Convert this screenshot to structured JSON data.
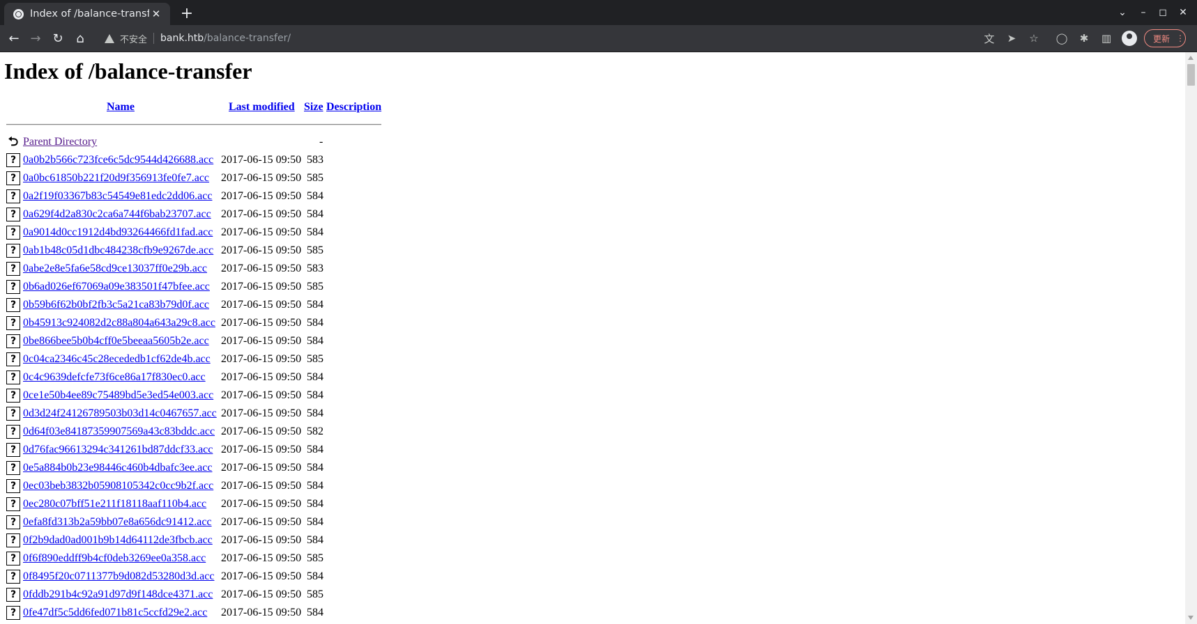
{
  "browser": {
    "tab_title": "Index of /balance-transfer",
    "tab_close": "✕",
    "new_tab": "+",
    "omnibox": {
      "security_label": "不安全",
      "host": "bank.htb",
      "path": "/balance-transfer/"
    },
    "update_label": "更新"
  },
  "page": {
    "heading": "Index of /balance-transfer",
    "columns": {
      "name": "Name",
      "last_modified": "Last modified",
      "size": "Size",
      "description": "Description"
    },
    "parent": {
      "label": "Parent Directory",
      "size": "-"
    },
    "files": [
      {
        "name": "0a0b2b566c723fce6c5dc9544d426688.acc",
        "modified": "2017-06-15 09:50",
        "size": "583"
      },
      {
        "name": "0a0bc61850b221f20d9f356913fe0fe7.acc",
        "modified": "2017-06-15 09:50",
        "size": "585"
      },
      {
        "name": "0a2f19f03367b83c54549e81edc2dd06.acc",
        "modified": "2017-06-15 09:50",
        "size": "584"
      },
      {
        "name": "0a629f4d2a830c2ca6a744f6bab23707.acc",
        "modified": "2017-06-15 09:50",
        "size": "584"
      },
      {
        "name": "0a9014d0cc1912d4bd93264466fd1fad.acc",
        "modified": "2017-06-15 09:50",
        "size": "584"
      },
      {
        "name": "0ab1b48c05d1dbc484238cfb9e9267de.acc",
        "modified": "2017-06-15 09:50",
        "size": "585"
      },
      {
        "name": "0abe2e8e5fa6e58cd9ce13037ff0e29b.acc",
        "modified": "2017-06-15 09:50",
        "size": "583"
      },
      {
        "name": "0b6ad026ef67069a09e383501f47bfee.acc",
        "modified": "2017-06-15 09:50",
        "size": "585"
      },
      {
        "name": "0b59b6f62b0bf2fb3c5a21ca83b79d0f.acc",
        "modified": "2017-06-15 09:50",
        "size": "584"
      },
      {
        "name": "0b45913c924082d2c88a804a643a29c8.acc",
        "modified": "2017-06-15 09:50",
        "size": "584"
      },
      {
        "name": "0be866bee5b0b4cff0e5beeaa5605b2e.acc",
        "modified": "2017-06-15 09:50",
        "size": "584"
      },
      {
        "name": "0c04ca2346c45c28ecededb1cf62de4b.acc",
        "modified": "2017-06-15 09:50",
        "size": "585"
      },
      {
        "name": "0c4c9639defcfe73f6ce86a17f830ec0.acc",
        "modified": "2017-06-15 09:50",
        "size": "584"
      },
      {
        "name": "0ce1e50b4ee89c75489bd5e3ed54e003.acc",
        "modified": "2017-06-15 09:50",
        "size": "584"
      },
      {
        "name": "0d3d24f24126789503b03d14c0467657.acc",
        "modified": "2017-06-15 09:50",
        "size": "584"
      },
      {
        "name": "0d64f03e84187359907569a43c83bddc.acc",
        "modified": "2017-06-15 09:50",
        "size": "582"
      },
      {
        "name": "0d76fac96613294c341261bd87ddcf33.acc",
        "modified": "2017-06-15 09:50",
        "size": "584"
      },
      {
        "name": "0e5a884b0b23e98446c460b4dbafc3ee.acc",
        "modified": "2017-06-15 09:50",
        "size": "584"
      },
      {
        "name": "0ec03beb3832b05908105342c0cc9b2f.acc",
        "modified": "2017-06-15 09:50",
        "size": "584"
      },
      {
        "name": "0ec280c07bff51e211f18118aaf110b4.acc",
        "modified": "2017-06-15 09:50",
        "size": "584"
      },
      {
        "name": "0efa8fd313b2a59bb07e8a656dc91412.acc",
        "modified": "2017-06-15 09:50",
        "size": "584"
      },
      {
        "name": "0f2b9dad0ad001b9b14d64112de3fbcb.acc",
        "modified": "2017-06-15 09:50",
        "size": "584"
      },
      {
        "name": "0f6f890eddff9b4cf0deb3269ee0a358.acc",
        "modified": "2017-06-15 09:50",
        "size": "585"
      },
      {
        "name": "0f8495f20c0711377b9d082d53280d3d.acc",
        "modified": "2017-06-15 09:50",
        "size": "584"
      },
      {
        "name": "0fddb291b4c92a91d97d9f148dce4371.acc",
        "modified": "2017-06-15 09:50",
        "size": "585"
      },
      {
        "name": "0fe47df5c5dd6fed071b81c5ccfd29e2.acc",
        "modified": "2017-06-15 09:50",
        "size": "584"
      }
    ]
  }
}
